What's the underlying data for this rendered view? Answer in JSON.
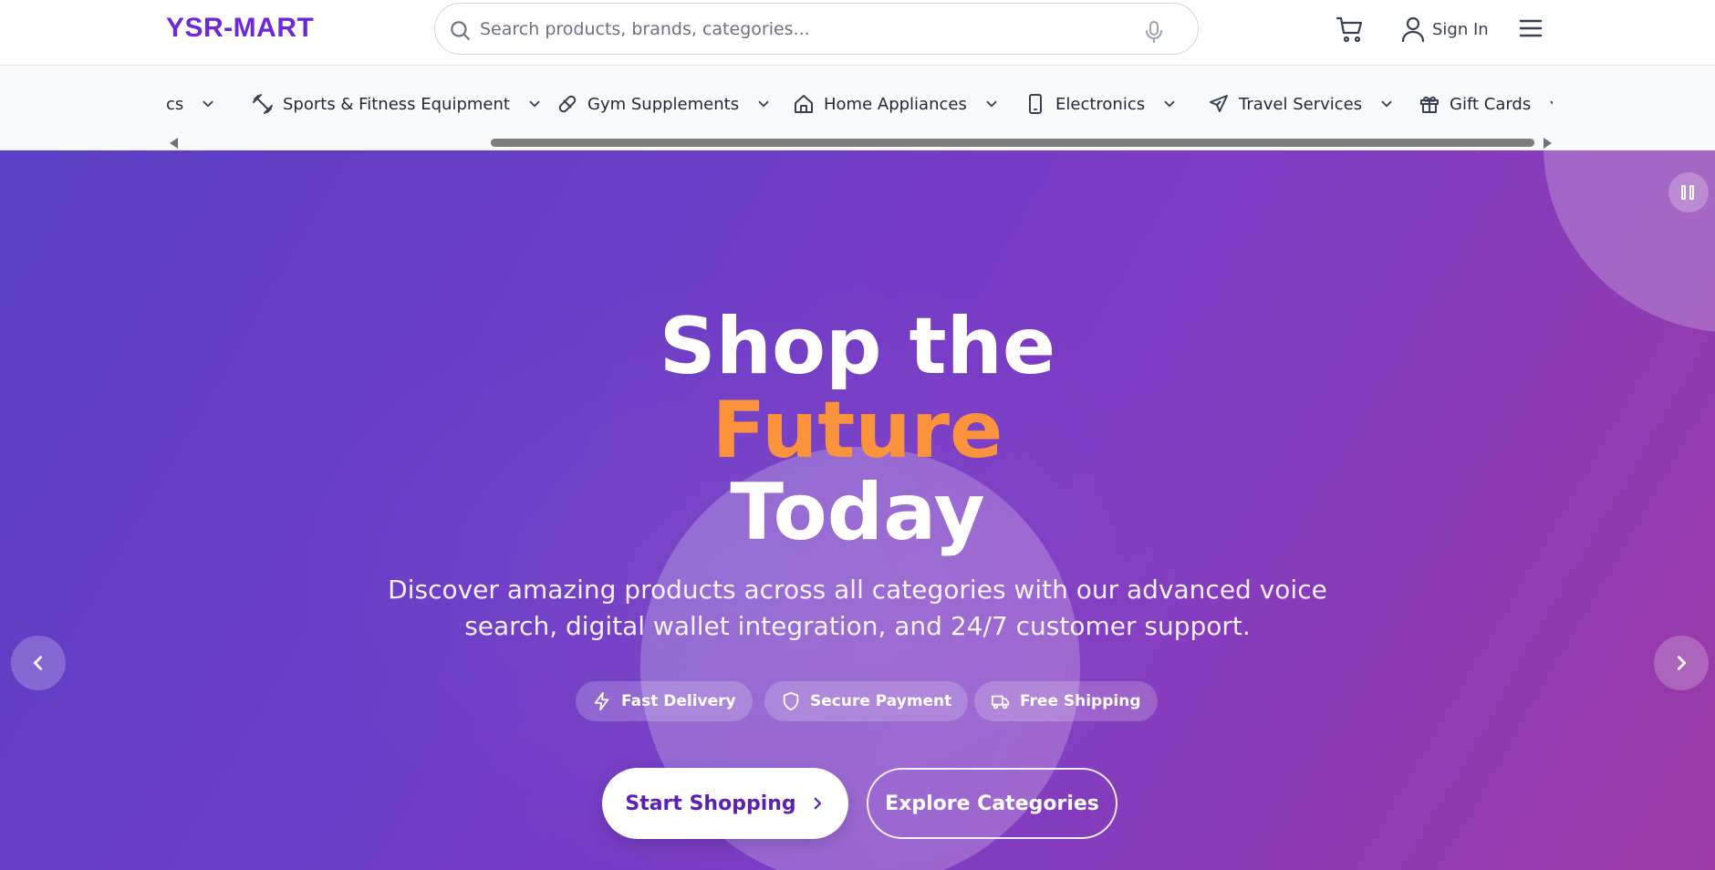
{
  "app": {
    "logo": "YSR-MART"
  },
  "header": {
    "search_placeholder": "Search products, brands, categories...",
    "signin_label": "Sign In"
  },
  "categories": {
    "partial_label": "cs",
    "items": [
      {
        "label": "Sports & Fitness Equipment",
        "icon": "dumbbell-icon"
      },
      {
        "label": "Gym Supplements",
        "icon": "pill-icon"
      },
      {
        "label": "Home Appliances",
        "icon": "home-icon"
      },
      {
        "label": "Electronics",
        "icon": "smartphone-icon"
      },
      {
        "label": "Travel Services",
        "icon": "plane-icon"
      },
      {
        "label": "Gift Cards",
        "icon": "gift-icon"
      }
    ]
  },
  "hero": {
    "title_line1": "Shop the",
    "title_line2": "Future",
    "title_line3": "Today",
    "subtitle": "Discover amazing products across all categories with our advanced voice search, digital wallet integration, and 24/7 customer support.",
    "features": [
      {
        "label": "Fast Delivery",
        "icon": "lightning-icon"
      },
      {
        "label": "Secure Payment",
        "icon": "shield-icon"
      },
      {
        "label": "Free Shipping",
        "icon": "truck-icon"
      }
    ],
    "primary_button": "Start Shopping",
    "secondary_button": "Explore Categories"
  },
  "colors": {
    "brand": "#6d28d9",
    "accent": "#fb923c",
    "hero_gradient_start": "#5b3fc4",
    "hero_gradient_end": "#9b3aa5"
  }
}
